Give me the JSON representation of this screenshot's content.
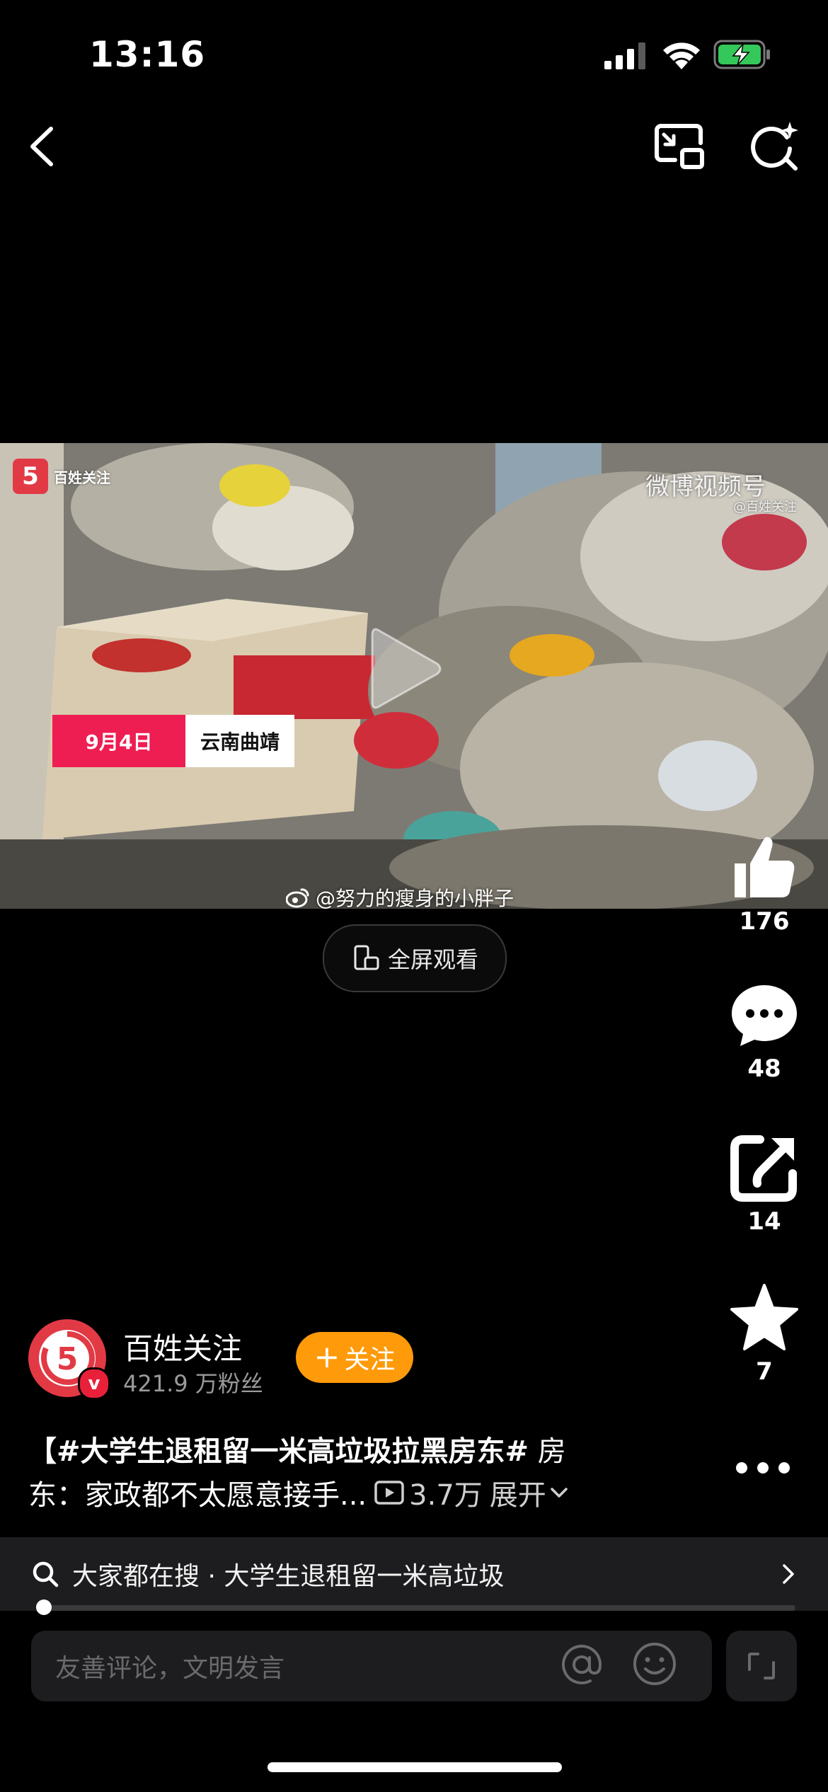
{
  "status_bar": {
    "time": "13:16"
  },
  "video": {
    "watermark_left": "百姓关注",
    "watermark_right": "微博视频号",
    "watermark_right_sub": "@百姓关注",
    "date_tag": "9月4日",
    "location_tag": "云南曲靖",
    "credit": "@努力的瘦身的小胖子",
    "fullscreen_label": "全屏观看"
  },
  "actions": {
    "like_count": "176",
    "comment_count": "48",
    "share_count": "14",
    "favorite_count": "7"
  },
  "author": {
    "name": "百姓关注",
    "fans": "421.9 万粉丝",
    "follow_label": "关注"
  },
  "post": {
    "title": "【#大学生退租留一米高垃圾拉黑房东#",
    "title_rest": " 房",
    "line2": "东：家政都不太愿意接手...",
    "views": "3.7万",
    "expand": "展开"
  },
  "search": {
    "text": "大家都在搜 · 大学生退租留一米高垃圾"
  },
  "playback": {
    "progress": 0.005
  },
  "comment": {
    "placeholder": "友善评论，文明发言"
  },
  "colors": {
    "accent_red": "#ee1d52",
    "follow_orange": "#ff9a0a",
    "background": "#000000"
  }
}
